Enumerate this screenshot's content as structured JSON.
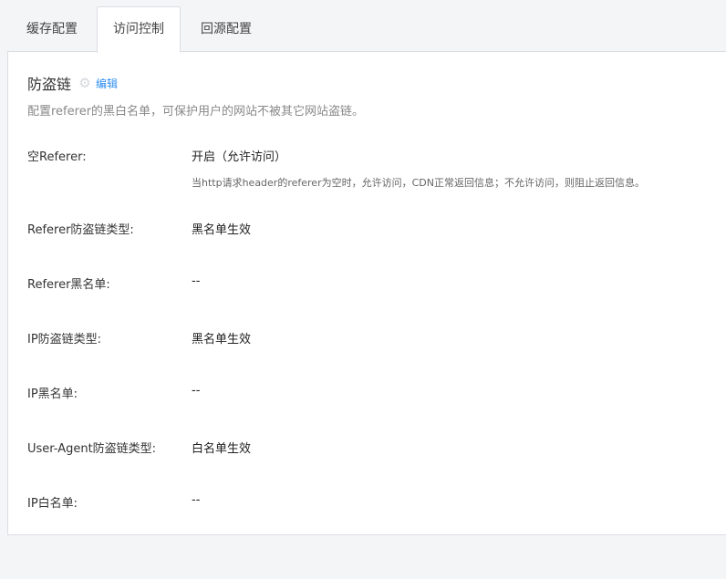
{
  "tabs": [
    {
      "label": "缓存配置",
      "active": false
    },
    {
      "label": "访问控制",
      "active": true
    },
    {
      "label": "回源配置",
      "active": false
    }
  ],
  "section": {
    "title": "防盗链",
    "edit_label": "编辑",
    "description": "配置referer的黑白名单，可保护用户的网站不被其它网站盗链。"
  },
  "rows": [
    {
      "label": "空Referer:",
      "value": "开启（允许访问）",
      "hint": "当http请求header的referer为空时，允许访问，CDN正常返回信息；不允许访问，则阻止返回信息。"
    },
    {
      "label": "Referer防盗链类型:",
      "value": "黑名单生效"
    },
    {
      "label": "Referer黑名单:",
      "value": "--"
    },
    {
      "label": "IP防盗链类型:",
      "value": "黑名单生效"
    },
    {
      "label": "IP黑名单:",
      "value": "--"
    },
    {
      "label": "User-Agent防盗链类型:",
      "value": "白名单生效"
    },
    {
      "label": "IP白名单:",
      "value": "--"
    }
  ],
  "colors": {
    "accent": "#2d8cf0",
    "border": "#dcdee2",
    "background": "#f4f5f7"
  },
  "icons": {
    "edit_icon": "gear-icon"
  }
}
